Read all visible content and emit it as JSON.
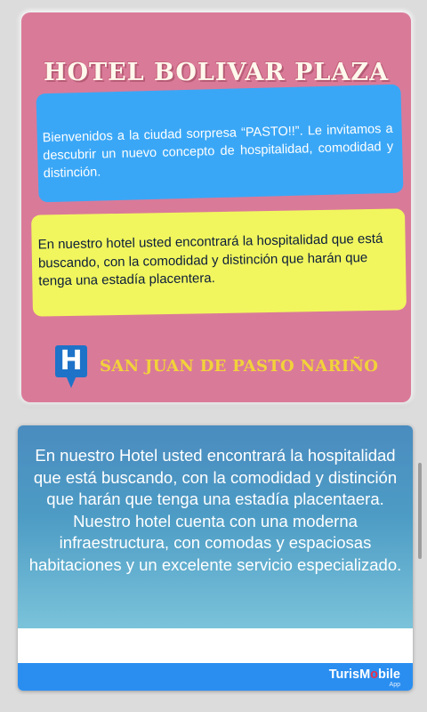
{
  "hotel": {
    "title": "HOTEL BOLIVAR PLAZA",
    "welcome_text": "Bienvenidos a la ciudad sorpresa “PASTO!!”. Le invitamos a descubrir un nuevo concepto de hospitalidad, comodidad y distinción.",
    "highlight_text": "En nuestro hotel usted encontrará la hospitalidad que está buscando, con la comodidad y distinción que harán que tenga una estadía placentera.",
    "location": "SAN JUAN DE PASTO NARIÑO",
    "location_icon": "H"
  },
  "info": {
    "description": "En nuestro Hotel usted encontrará la hospitalidad que está buscando, con la comodidad y distinción que harán que tenga una estadía  placentaera. Nuestro hotel cuenta con una moderna infraestructura, con comodas y espaciosas habitaciones y un excelente servicio especializado."
  },
  "brand": {
    "name_prefix": "TurisM",
    "name_pin": "o",
    "name_suffix": "bile",
    "subtitle": "App"
  },
  "colors": {
    "pink_card": "#da7a99",
    "blue_bubble": "#3aa7f6",
    "yellow_bubble": "#f1f65e",
    "location_text": "#f2d23a",
    "brand_bar": "#2a8ef0"
  }
}
